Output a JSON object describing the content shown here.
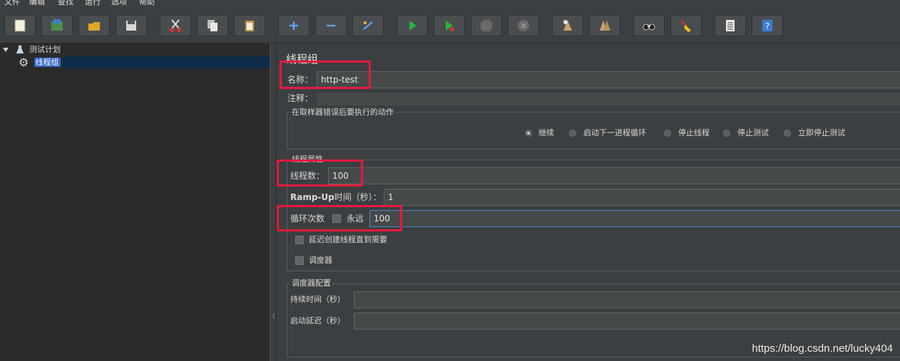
{
  "menu": [
    "文件",
    "编辑",
    "查找",
    "运行",
    "选项",
    "帮助"
  ],
  "toolbar": {
    "icons": [
      "new-icon",
      "templates-icon",
      "open-icon",
      "save-icon",
      "cut-icon",
      "copy-icon",
      "paste-icon",
      "expand-icon",
      "collapse-icon",
      "toggle-icon",
      "start-icon",
      "start-no-pause-icon",
      "stop-icon",
      "shutdown-icon",
      "clear-icon",
      "clear-all-icon",
      "search-icon",
      "reset-search-icon",
      "function-helper-icon",
      "help-icon"
    ]
  },
  "tree": {
    "root_label": "测试计划",
    "child_label": "线程组"
  },
  "panel": {
    "title": "线程组",
    "name_label": "名称：",
    "name_value": "http-test",
    "comment_label": "注释：",
    "comment_value": "",
    "error_group_title": "在取样器错误后要执行的动作",
    "error_options": [
      "继续",
      "启动下一进程循环",
      "停止线程",
      "停止测试",
      "立即停止测试"
    ],
    "error_selected": "继续",
    "thread_group_title": "线程属性",
    "threads_label": "线程数：",
    "threads_value": "100",
    "rampup_label_bold": "Ramp-Up",
    "rampup_label_rest": "时间（秒）：",
    "rampup_value": "1",
    "loop_label": "循环次数",
    "forever_label": "永远",
    "loop_value": "100",
    "delay_label": "延迟创建线程直到需要",
    "scheduler_label": "调度器",
    "scheduler_group_title": "调度器配置",
    "duration_label": "持续时间（秒）",
    "duration_value": "",
    "startup_label": "启动延迟（秒）",
    "startup_value": ""
  },
  "watermark": "https://blog.csdn.net/lucky404",
  "colors": {
    "highlight": "#e8193c",
    "selection": "#2f65ca",
    "accent_border": "#4a88c7"
  }
}
